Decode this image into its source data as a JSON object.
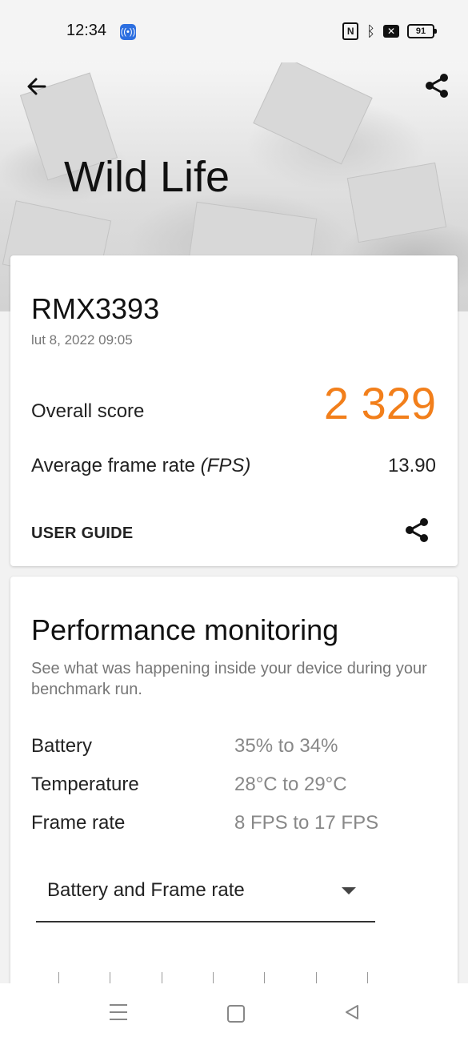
{
  "status_bar": {
    "time": "12:34",
    "battery_level": "91",
    "icons": [
      "hotspot-icon",
      "nfc-icon",
      "bluetooth-icon",
      "no-sim-icon",
      "battery-icon"
    ]
  },
  "header": {
    "title": "Wild Life",
    "icons": [
      "back-arrow-icon",
      "share-icon"
    ]
  },
  "result_card": {
    "device": "RMX3393",
    "date": "lut 8, 2022 09:05",
    "overall_label": "Overall score",
    "overall_value": "2 329",
    "fps_label": "Average frame rate",
    "fps_unit": "(FPS)",
    "fps_value": "13.90",
    "user_guide": "USER GUIDE",
    "accent_color": "#f27f1b"
  },
  "performance": {
    "title": "Performance monitoring",
    "description": "See what was happening inside your device during your benchmark run.",
    "stats": [
      {
        "label": "Battery",
        "value": "35% to 34%"
      },
      {
        "label": "Temperature",
        "value": "28°C to 29°C"
      },
      {
        "label": "Frame rate",
        "value": "8 FPS to 17 FPS"
      }
    ],
    "dropdown_selected": "Battery and Frame rate"
  },
  "nav_bar": {
    "icons": [
      "menu-icon",
      "home-icon",
      "back-icon"
    ]
  }
}
